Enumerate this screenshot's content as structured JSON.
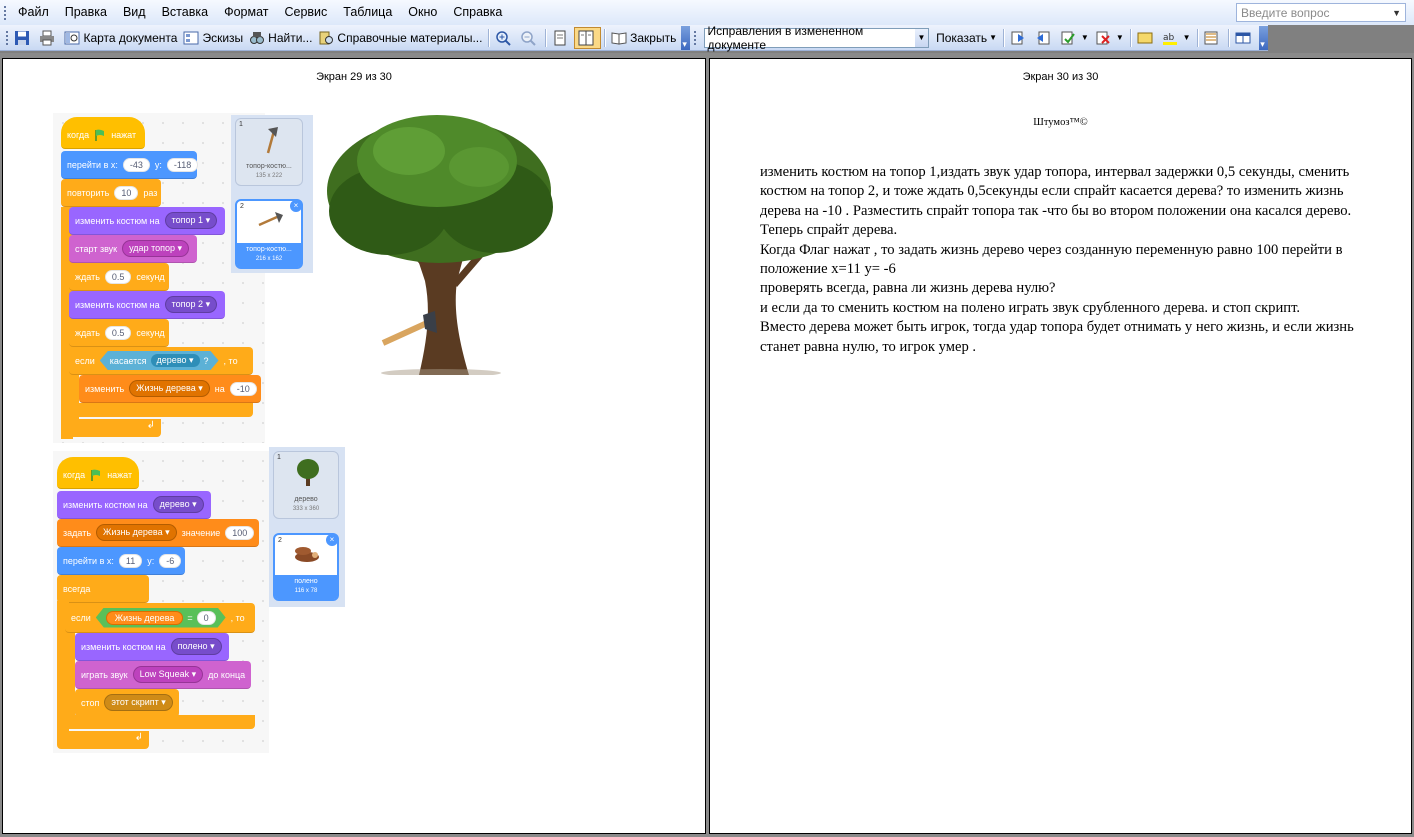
{
  "menu": [
    "Файл",
    "Правка",
    "Вид",
    "Вставка",
    "Формат",
    "Сервис",
    "Таблица",
    "Окно",
    "Справка"
  ],
  "ask_placeholder": "Введите вопрос",
  "toolbar": {
    "doc_map": "Карта документа",
    "thumbnails": "Эскизы",
    "find": "Найти...",
    "reference": "Справочные материалы...",
    "close": "Закрыть",
    "track_mode": "Исправления в измененном документе",
    "show": "Показать"
  },
  "left_page": {
    "screen_label": "Экран 29 из 30",
    "script1": {
      "when_flag": "когда",
      "clicked": "нажат",
      "goto_label": "перейти в x:",
      "goto_x": "-43",
      "y_label": "y:",
      "goto_y": "-118",
      "repeat": "повторить",
      "repeat_n": "10",
      "times": "раз",
      "switch_costume": "изменить костюм на",
      "costume1": "топор 1",
      "start_sound": "старт звук",
      "sound1": "удар топор",
      "wait": "ждать",
      "wait_val1": "0.5",
      "seconds": "секунд",
      "costume2": "топор 2",
      "wait_val2": "0.5",
      "if": "если",
      "touching": "касается",
      "touch_target": "дерево",
      "question": "?",
      "then": ", то",
      "change": "изменить",
      "var_name": "Жизнь дерева",
      "by": "на",
      "change_val": "-10"
    },
    "script2": {
      "when_flag": "когда",
      "clicked": "нажат",
      "switch_costume": "изменить костюм на",
      "costume": "дерево",
      "set": "задать",
      "var_name": "Жизнь дерева",
      "value_label": "значение",
      "set_val": "100",
      "goto_label": "перейти в x:",
      "goto_x": "11",
      "y_label": "y:",
      "goto_y": "-6",
      "forever": "всегда",
      "if": "если",
      "eq": "=",
      "eq_val": "0",
      "then": ", то",
      "costume_log": "полено",
      "play_sound": "играть звук",
      "sound": "Low Squeak",
      "until_done": "до конца",
      "stop": "стоп",
      "stop_what": "этот скрипт"
    },
    "costumes_axe": [
      {
        "num": "1",
        "name": "топор-костю...",
        "size": "135 x 222"
      },
      {
        "num": "2",
        "name": "топор-костю...",
        "size": "216 x 162"
      }
    ],
    "costumes_tree": [
      {
        "num": "1",
        "name": "дерево",
        "size": "333 x 360"
      },
      {
        "num": "2",
        "name": "полено",
        "size": "116 x 78"
      }
    ]
  },
  "right_page": {
    "screen_label": "Экран 30 из 30",
    "brand": "Штумоз™©",
    "paragraphs": [
      "изменить костюм на  топор 1,издать звук удар топора, интервал задержки 0,5 секунды, сменить костюм на топор 2, и тоже ждать 0,5секунды если спрайт касается дерева? то изменить жизнь дерева на -10 . Разместить спрайт топора так -что бы во втором положении она касался дерево.",
      "Теперь спрайт дерева.",
      "Когда Флаг нажат , то задать жизнь дерево через созданную переменную равно 100 перейти в положение x=11 y= -6",
      "проверять всегда, равна ли жизнь дерева нулю?",
      "и если да то сменить костюм на полено играть звук срубленного дерева. и стоп скрипт.",
      "Вместо дерева может быть игрок, тогда удар топора будет отнимать у него жизнь, и если жизнь станет равна нулю, то  игрок умер ."
    ]
  },
  "colors": {
    "events": "#ffbf00",
    "motion": "#4c97ff",
    "control": "#ffab19",
    "looks": "#9966ff",
    "sound": "#cf63cf",
    "variables": "#ff8c1a",
    "sensing": "#5cb1d6",
    "operators": "#59c059"
  },
  "icons": [
    "save-icon",
    "print-icon",
    "doc-map-icon",
    "thumbnails-icon",
    "find-icon",
    "reference-icon",
    "zoom-in-icon",
    "zoom-out-icon",
    "one-page-icon",
    "multi-page-icon",
    "close-book-icon"
  ]
}
